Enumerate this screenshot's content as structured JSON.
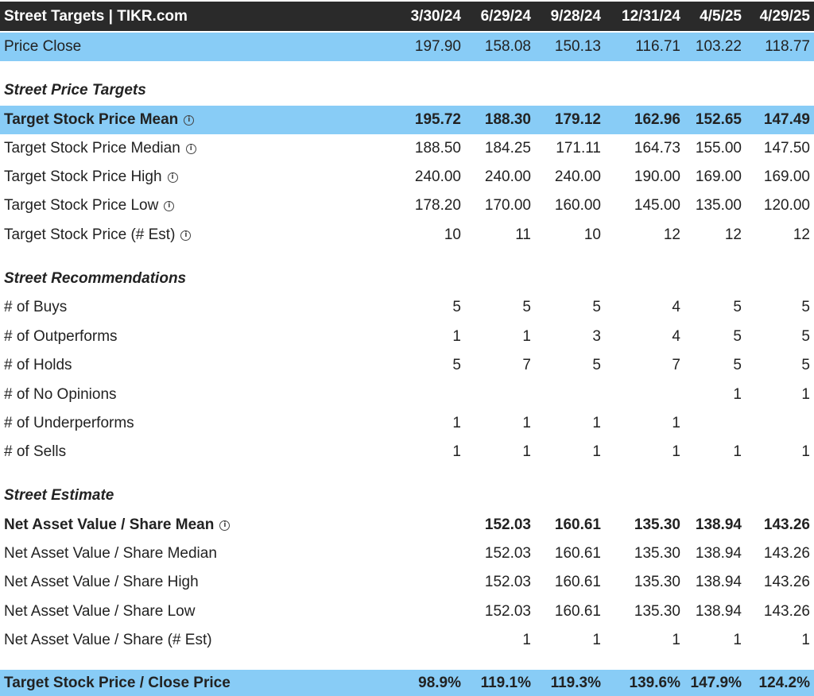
{
  "header": {
    "title": "Street Targets | TIKR.com",
    "periods": [
      "3/30/24",
      "6/29/24",
      "9/28/24",
      "12/31/24",
      "4/5/25",
      "4/29/25"
    ]
  },
  "price_close": {
    "label": "Price Close",
    "values": [
      "197.90",
      "158.08",
      "150.13",
      "116.71",
      "103.22",
      "118.77"
    ]
  },
  "street_price_targets": {
    "title": "Street Price Targets",
    "rows": [
      {
        "label": "Target Stock Price Mean",
        "info_icon": true,
        "values": [
          "195.72",
          "188.30",
          "179.12",
          "162.96",
          "152.65",
          "147.49"
        ]
      },
      {
        "label": "Target Stock Price Median",
        "info_icon": true,
        "values": [
          "188.50",
          "184.25",
          "171.11",
          "164.73",
          "155.00",
          "147.50"
        ]
      },
      {
        "label": "Target Stock Price High",
        "info_icon": true,
        "values": [
          "240.00",
          "240.00",
          "240.00",
          "190.00",
          "169.00",
          "169.00"
        ]
      },
      {
        "label": "Target Stock Price Low",
        "info_icon": true,
        "values": [
          "178.20",
          "170.00",
          "160.00",
          "145.00",
          "135.00",
          "120.00"
        ]
      },
      {
        "label": "Target Stock Price (# Est)",
        "info_icon": true,
        "values": [
          "10",
          "11",
          "10",
          "12",
          "12",
          "12"
        ]
      }
    ]
  },
  "street_recommendations": {
    "title": "Street Recommendations",
    "rows": [
      {
        "label": "# of Buys",
        "values": [
          "5",
          "5",
          "5",
          "4",
          "5",
          "5"
        ]
      },
      {
        "label": "# of Outperforms",
        "values": [
          "1",
          "1",
          "3",
          "4",
          "5",
          "5"
        ]
      },
      {
        "label": "# of Holds",
        "values": [
          "5",
          "7",
          "5",
          "7",
          "5",
          "5"
        ]
      },
      {
        "label": "# of No Opinions",
        "values": [
          "",
          "",
          "",
          "",
          "1",
          "1"
        ]
      },
      {
        "label": "# of Underperforms",
        "values": [
          "1",
          "1",
          "1",
          "1",
          "",
          ""
        ]
      },
      {
        "label": "# of Sells",
        "values": [
          "1",
          "1",
          "1",
          "1",
          "1",
          "1"
        ]
      }
    ]
  },
  "street_estimate": {
    "title": "Street Estimate",
    "rows": [
      {
        "label": "Net Asset Value / Share Mean",
        "info_icon": true,
        "values": [
          "",
          "152.03",
          "160.61",
          "135.30",
          "138.94",
          "143.26"
        ]
      },
      {
        "label": "Net Asset Value / Share Median",
        "values": [
          "",
          "152.03",
          "160.61",
          "135.30",
          "138.94",
          "143.26"
        ]
      },
      {
        "label": "Net Asset Value / Share High",
        "values": [
          "",
          "152.03",
          "160.61",
          "135.30",
          "138.94",
          "143.26"
        ]
      },
      {
        "label": "Net Asset Value / Share Low",
        "values": [
          "",
          "152.03",
          "160.61",
          "135.30",
          "138.94",
          "143.26"
        ]
      },
      {
        "label": "Net Asset Value / Share (# Est)",
        "values": [
          "",
          "1",
          "1",
          "1",
          "1",
          "1"
        ]
      }
    ]
  },
  "target_close_ratio": {
    "label": "Target Stock Price / Close Price",
    "values": [
      "98.9%",
      "119.1%",
      "119.3%",
      "139.6%",
      "147.9%",
      "124.2%"
    ]
  },
  "colors": {
    "header_bg": "#2a2a2a",
    "highlight_bg": "#88ccf6"
  },
  "icons": {
    "info": "info-circle-icon"
  }
}
